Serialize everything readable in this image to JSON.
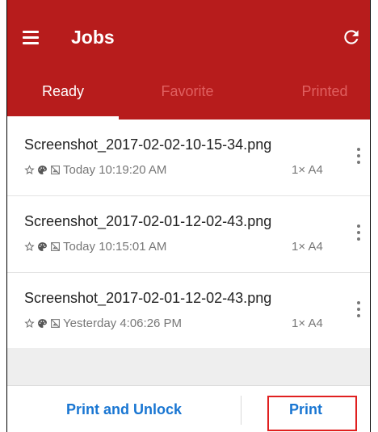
{
  "toolbar": {
    "title": "Jobs",
    "menu_icon": "hamburger-menu-icon",
    "refresh_icon": "refresh-icon",
    "background_color": "#b71c1c"
  },
  "tabs": [
    {
      "label": "Ready",
      "active": true
    },
    {
      "label": "Favorite",
      "active": false
    },
    {
      "label": "Printed",
      "active": false
    }
  ],
  "jobs": [
    {
      "filename": "Screenshot_2017-02-02-10-15-34.png",
      "time": "Today 10:19:20 AM",
      "copies": "1× A4"
    },
    {
      "filename": "Screenshot_2017-02-01-12-02-43.png",
      "time": "Today 10:15:01 AM",
      "copies": "1× A4"
    },
    {
      "filename": "Screenshot_2017-02-01-12-02-43.png",
      "time": "Yesterday 4:06:26 PM",
      "copies": "1× A4"
    }
  ],
  "job_icons": [
    "star-outline-icon",
    "palette-icon",
    "no-photo-icon",
    "more-vert-icon"
  ],
  "bottom_bar": {
    "print_and_unlock_label": "Print and Unlock",
    "print_label": "Print",
    "accent_color": "#1976d2"
  }
}
